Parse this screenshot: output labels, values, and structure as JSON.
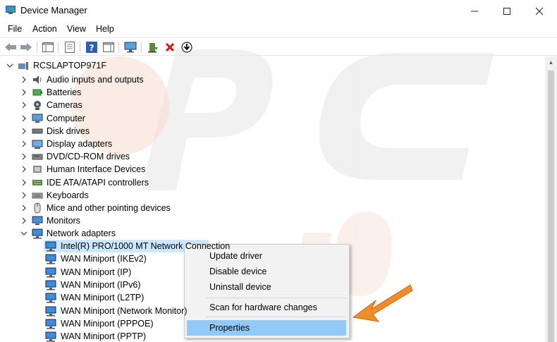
{
  "window": {
    "title": "Device Manager",
    "controls": [
      "minimize",
      "maximize",
      "close"
    ]
  },
  "menubar": {
    "items": [
      "File",
      "Action",
      "View",
      "Help"
    ]
  },
  "toolbar": {
    "icons": [
      "back-arrow-icon",
      "forward-arrow-icon",
      "show-hide-tree-icon",
      "properties-sheet-icon",
      "help-icon",
      "action-pane-icon",
      "monitor-icon",
      "update-driver-icon",
      "uninstall-x-icon",
      "download-icon"
    ]
  },
  "tree": {
    "root": "RCSLAPTOP971F",
    "categories": [
      {
        "label": "Audio inputs and outputs",
        "icon": "speaker-icon"
      },
      {
        "label": "Batteries",
        "icon": "battery-icon"
      },
      {
        "label": "Cameras",
        "icon": "camera-icon"
      },
      {
        "label": "Computer",
        "icon": "computer-icon"
      },
      {
        "label": "Disk drives",
        "icon": "disk-icon"
      },
      {
        "label": "Display adapters",
        "icon": "display-icon"
      },
      {
        "label": "DVD/CD-ROM drives",
        "icon": "dvd-icon"
      },
      {
        "label": "Human Interface Devices",
        "icon": "hid-icon"
      },
      {
        "label": "IDE ATA/ATAPI controllers",
        "icon": "ide-icon"
      },
      {
        "label": "Keyboards",
        "icon": "keyboard-icon"
      },
      {
        "label": "Mice and other pointing devices",
        "icon": "mouse-icon"
      },
      {
        "label": "Monitors",
        "icon": "monitor-icon"
      },
      {
        "label": "Network adapters",
        "icon": "network-icon"
      }
    ],
    "network_children": [
      "Intel(R) PRO/1000 MT Network Connection",
      "WAN Miniport (IKEv2)",
      "WAN Miniport (IP)",
      "WAN Miniport (IPv6)",
      "WAN Miniport (L2TP)",
      "WAN Miniport (Network Monitor)",
      "WAN Miniport (PPPOE)",
      "WAN Miniport (PPTP)"
    ]
  },
  "context_menu": {
    "update": "Update driver",
    "disable": "Disable device",
    "uninstall": "Uninstall device",
    "scan": "Scan for hardware changes",
    "properties": "Properties"
  },
  "colors": {
    "highlight": "#91c9f7",
    "arrow": "#f28c28",
    "watermark": "#e6e6e6"
  }
}
